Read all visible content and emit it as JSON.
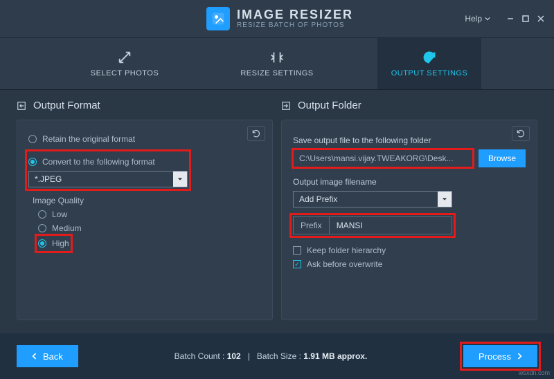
{
  "app": {
    "title": "IMAGE RESIZER",
    "subtitle": "RESIZE BATCH OF PHOTOS",
    "help": "Help"
  },
  "tabs": {
    "select": "SELECT PHOTOS",
    "resize": "RESIZE SETTINGS",
    "output": "OUTPUT SETTINGS"
  },
  "format_panel": {
    "title": "Output Format",
    "retain": "Retain the original format",
    "convert": "Convert to the following format",
    "format_value": "*.JPEG",
    "quality_label": "Image Quality",
    "low": "Low",
    "medium": "Medium",
    "high": "High"
  },
  "folder_panel": {
    "title": "Output Folder",
    "save_to": "Save output file to the following folder",
    "path": "C:\\Users\\mansi.vijay.TWEAKORG\\Desk...",
    "browse": "Browse",
    "filename_label": "Output image filename",
    "filename_mode": "Add Prefix",
    "prefix_label": "Prefix",
    "prefix_value": "MANSI",
    "keep_hierarchy": "Keep folder hierarchy",
    "ask_overwrite": "Ask before overwrite"
  },
  "footer": {
    "back": "Back",
    "batch_count_label": "Batch Count :",
    "batch_count": "102",
    "batch_size_label": "Batch Size :",
    "batch_size": "1.91 MB approx.",
    "separator": "|",
    "process": "Process"
  },
  "watermark": "wsxdn.com"
}
